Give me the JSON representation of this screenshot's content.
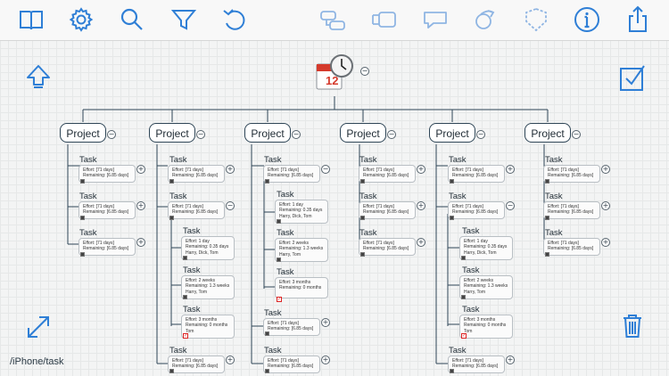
{
  "toolbar": {
    "icons": [
      "book-icon",
      "gear-icon",
      "search-icon",
      "filter-icon",
      "undo-icon",
      "add-child-node-icon",
      "add-sibling-node-icon",
      "callout-icon",
      "relationship-icon",
      "boundary-icon",
      "info-icon",
      "share-icon"
    ]
  },
  "accent_color": "#2f7fd6",
  "path": "/iPhone/task",
  "root": {
    "icon": "calendar-clock-icon",
    "toggle": "−"
  },
  "project_label": "Project",
  "task_label": "Task",
  "effort_71": "Effort: [71 days]",
  "remaining_685": "Remaining: [6.85 days]",
  "sub": {
    "a_effort": "Effort: 1 day",
    "a_remaining": "Remaining: 0.35 days",
    "a_people": "Harry, Dick, Tom",
    "b_effort": "Effort: 2 weeks",
    "b_remaining": "Remaining: 1.3 weeks",
    "b_people": "Harry, Tom",
    "c_effort": "Effort: 3 months",
    "c_remaining": "Remaining: 0 months",
    "c_people": "Tom"
  },
  "toggles": {
    "plus": "+",
    "minus": "−"
  }
}
